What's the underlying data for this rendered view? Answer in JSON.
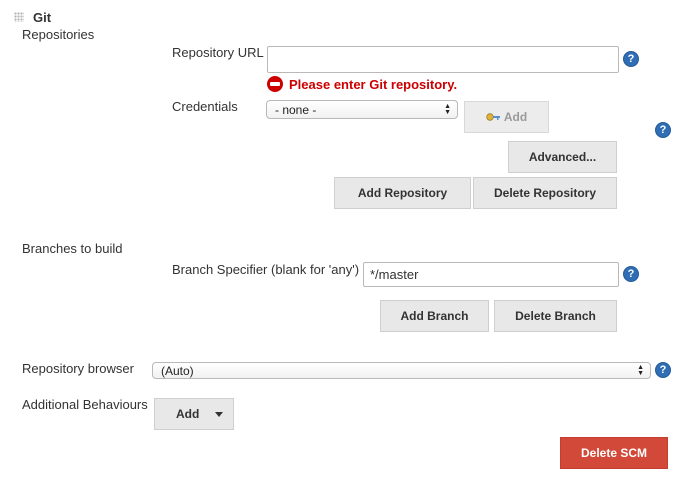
{
  "section": {
    "title": "Git",
    "grip_icon": "drag-handle-icon"
  },
  "repositories": {
    "label": "Repositories",
    "url_label": "Repository URL",
    "url_value": "",
    "error_text": "Please enter Git repository.",
    "credentials_label": "Credentials",
    "credentials_selected": "- none -",
    "add_credentials_label": "Add",
    "advanced_label": "Advanced...",
    "add_repository_label": "Add Repository",
    "delete_repository_label": "Delete Repository"
  },
  "branches": {
    "label": "Branches to build",
    "specifier_label": "Branch Specifier (blank for 'any')",
    "specifier_value": "*/master",
    "add_branch_label": "Add Branch",
    "delete_branch_label": "Delete Branch"
  },
  "browser": {
    "label": "Repository browser",
    "selected": "(Auto)"
  },
  "behaviours": {
    "label": "Additional Behaviours",
    "add_label": "Add"
  },
  "delete_scm_label": "Delete SCM",
  "help_glyph": "?",
  "colors": {
    "error": "#cc0000",
    "help": "#2f6eb5",
    "danger": "#d24939"
  }
}
